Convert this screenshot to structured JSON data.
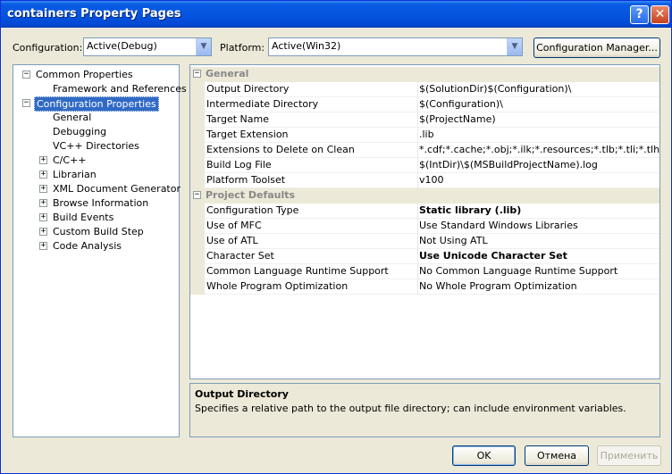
{
  "window": {
    "title": "containers Property Pages"
  },
  "toolbar": {
    "configuration_label": "Configuration:",
    "configuration_value": "Active(Debug)",
    "platform_label": "Platform:",
    "platform_value": "Active(Win32)",
    "config_manager_label": "Configuration Manager..."
  },
  "tree": [
    {
      "label": "Common Properties",
      "expander": "−"
    },
    {
      "label": "Framework and References"
    },
    {
      "label": "Configuration Properties",
      "expander": "−",
      "selected": true
    },
    {
      "label": "General"
    },
    {
      "label": "Debugging"
    },
    {
      "label": "VC++ Directories"
    },
    {
      "label": "C/C++",
      "expander": "+"
    },
    {
      "label": "Librarian",
      "expander": "+"
    },
    {
      "label": "XML Document Generator",
      "expander": "+"
    },
    {
      "label": "Browse Information",
      "expander": "+"
    },
    {
      "label": "Build Events",
      "expander": "+"
    },
    {
      "label": "Custom Build Step",
      "expander": "+"
    },
    {
      "label": "Code Analysis",
      "expander": "+"
    }
  ],
  "grid": {
    "categories": [
      "General",
      "Project Defaults"
    ],
    "general": [
      {
        "name": "Output Directory",
        "value": "$(SolutionDir)$(Configuration)\\"
      },
      {
        "name": "Intermediate Directory",
        "value": "$(Configuration)\\"
      },
      {
        "name": "Target Name",
        "value": "$(ProjectName)"
      },
      {
        "name": "Target Extension",
        "value": ".lib"
      },
      {
        "name": "Extensions to Delete on Clean",
        "value": "*.cdf;*.cache;*.obj;*.ilk;*.resources;*.tlb;*.tli;*.tlh;*.t"
      },
      {
        "name": "Build Log File",
        "value": "$(IntDir)\\$(MSBuildProjectName).log"
      },
      {
        "name": "Platform Toolset",
        "value": "v100"
      }
    ],
    "defaults": [
      {
        "name": "Configuration Type",
        "value": "Static library (.lib)",
        "bold": true
      },
      {
        "name": "Use of MFC",
        "value": "Use Standard Windows Libraries"
      },
      {
        "name": "Use of ATL",
        "value": "Not Using ATL"
      },
      {
        "name": "Character Set",
        "value": "Use Unicode Character Set",
        "bold": true
      },
      {
        "name": "Common Language Runtime Support",
        "value": "No Common Language Runtime Support"
      },
      {
        "name": "Whole Program Optimization",
        "value": "No Whole Program Optimization"
      }
    ]
  },
  "description": {
    "title": "Output Directory",
    "text": "Specifies a relative path to the output file directory; can include environment variables."
  },
  "buttons": {
    "ok": "OK",
    "cancel": "Отмена",
    "apply": "Применить"
  },
  "colors": {
    "title_bar": "#0554e0",
    "selection": "#316ac5"
  }
}
